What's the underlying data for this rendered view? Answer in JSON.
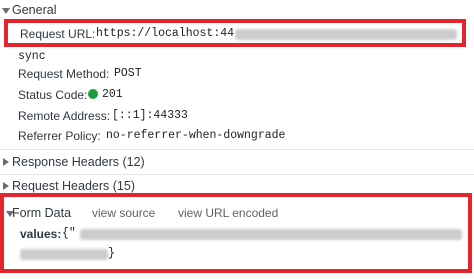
{
  "general": {
    "title": "General",
    "request_url_label": "Request URL:",
    "request_url_value": "https://localhost:44",
    "request_url_wrap": "sync",
    "request_method_label": "Request Method:",
    "request_method_value": "POST",
    "status_code_label": "Status Code:",
    "status_code_value": "201",
    "status_color": "#1e9e3a",
    "remote_address_label": "Remote Address:",
    "remote_address_value": "[::1]:44333",
    "referrer_policy_label": "Referrer Policy:",
    "referrer_policy_value": "no-referrer-when-downgrade"
  },
  "response_headers": {
    "title": "Response Headers (12)"
  },
  "request_headers": {
    "title": "Request Headers (15)"
  },
  "form_data": {
    "title": "Form Data",
    "view_source": "view source",
    "view_url_encoded": "view URL encoded",
    "values_label": "values:",
    "values_start": "{\"",
    "values_end": "}"
  },
  "highlight_color": "#e3262e"
}
